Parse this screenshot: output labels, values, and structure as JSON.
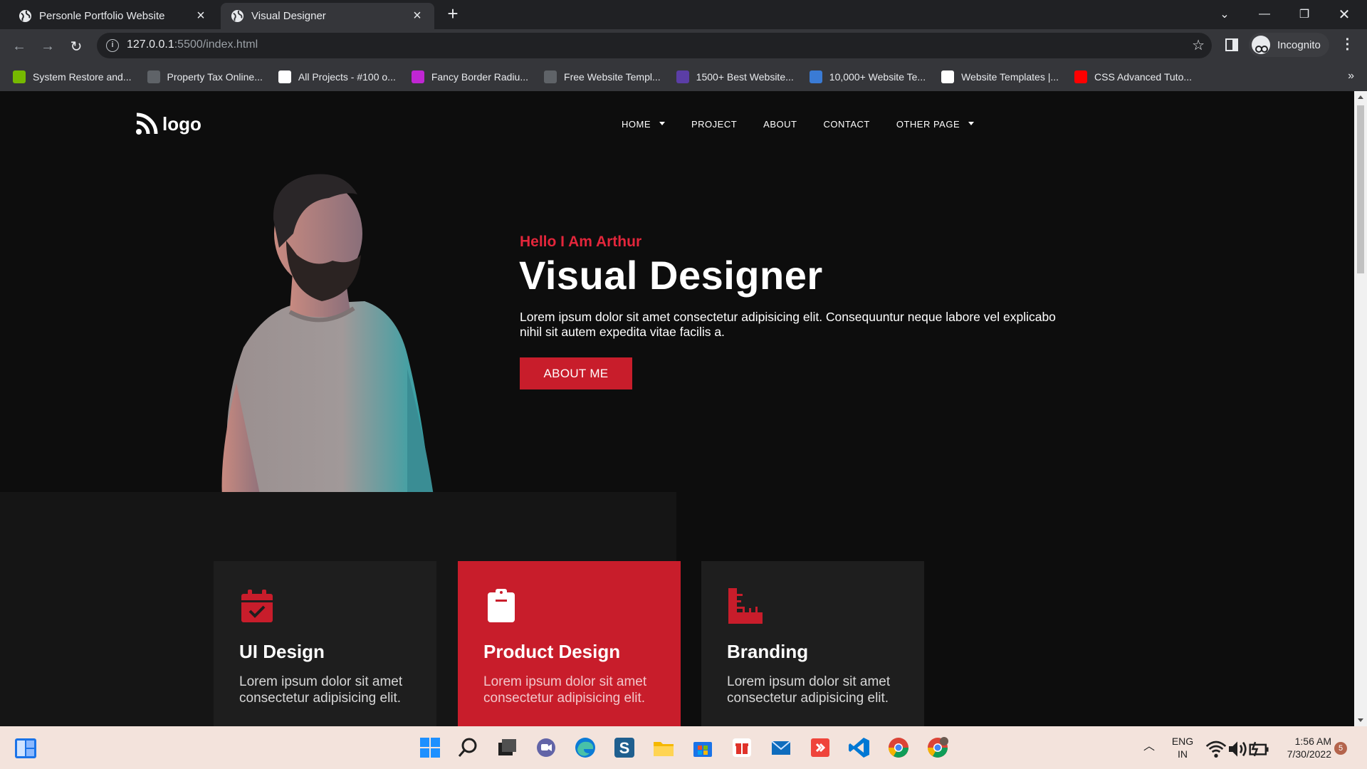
{
  "browser": {
    "tabs": [
      {
        "title": "Personle Portfolio Website",
        "active": false
      },
      {
        "title": "Visual Designer",
        "active": true
      }
    ],
    "url": {
      "host": "127.0.0.1",
      "path": ":5500/index.html"
    },
    "profile_label": "Incognito",
    "bookmarks": [
      {
        "label": "System Restore and...",
        "color": "#76b900"
      },
      {
        "label": "Property Tax Online...",
        "color": "#5f6368"
      },
      {
        "label": "All Projects - #100 o...",
        "color": "#ffffff"
      },
      {
        "label": "Fancy Border Radiu...",
        "color": "#c026d3"
      },
      {
        "label": "Free Website Templ...",
        "color": "#5f6368"
      },
      {
        "label": "1500+ Best Website...",
        "color": "#5b3ea6"
      },
      {
        "label": "10,000+ Website Te...",
        "color": "#3a7bd5"
      },
      {
        "label": "Website Templates |...",
        "color": "#ffffff"
      },
      {
        "label": "CSS Advanced Tuto...",
        "color": "#ff0000"
      }
    ]
  },
  "site": {
    "logo_text": "logo",
    "nav": [
      "HOME",
      "PROJECT",
      "ABOUT",
      "CONTACT",
      "OTHER PAGE"
    ],
    "hero": {
      "greeting": "Hello I Am Arthur",
      "title": "Visual Designer",
      "text": "Lorem ipsum dolor sit amet consectetur adipisicing elit. Consequuntur neque labore vel explicabo nihil sit autem expedita vitae facilis a.",
      "button": "ABOUT ME"
    },
    "services": [
      {
        "title": "UI Design",
        "text": "Lorem ipsum dolor sit amet consectetur adipisicing elit.",
        "icon": "calendar-check-icon"
      },
      {
        "title": "Product Design",
        "text": "Lorem ipsum dolor sit amet consectetur adipisicing elit.",
        "icon": "clipboard-icon"
      },
      {
        "title": "Branding",
        "text": "Lorem ipsum dolor sit amet consectetur adipisicing elit.",
        "icon": "ruler-icon"
      }
    ],
    "accent_color": "#c81d2b"
  },
  "taskbar": {
    "lang": "ENG",
    "region": "IN",
    "time": "1:56 AM",
    "date": "7/30/2022",
    "notification_count": "5"
  }
}
